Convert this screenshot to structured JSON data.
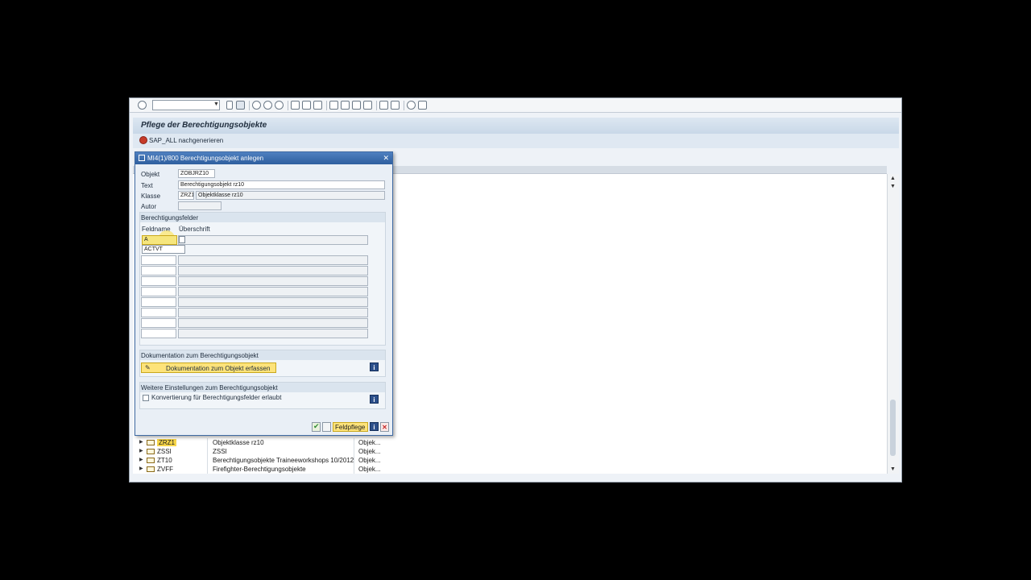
{
  "header": {
    "title": "Pflege der Berechtigungsobjekte"
  },
  "app_toolbar": {
    "regenerate_label": "SAP_ALL nachgenerieren"
  },
  "dialog": {
    "title": "MI4(1)/800 Berechtigungsobjekt anlegen",
    "objekt_label": "Objekt",
    "objekt_value": "ZOBJRZ10",
    "text_label": "Text",
    "text_value": "Berechtigungsobjekt rz10",
    "klasse_label": "Klasse",
    "klasse_value": "ZRZ1",
    "klasse_desc": "Objektklasse rz10",
    "autor_label": "Autor",
    "fields_group": {
      "title": "Berechtigungsfelder",
      "col_feldname": "Feldname",
      "col_ueberschrift": "Überschrift",
      "active_value": "A",
      "suggestion": "ACTVT"
    },
    "doc_group": {
      "title": "Dokumentation zum Berechtigungsobjekt",
      "button_label": "Dokumentation zum Objekt erfassen"
    },
    "settings_group": {
      "title": "Weitere Einstellungen zum Berechtigungsobjekt",
      "checkbox_label": "Konvertierung für Berechtigungsfelder erlaubt"
    },
    "buttons": {
      "field_label": "Feldpflege",
      "info_label": "i",
      "cancel_label": "✕"
    }
  },
  "tree": {
    "rows": [
      {
        "name": "ZRZ1",
        "desc": "Objektklasse rz10",
        "type": "Objek...",
        "selected": true
      },
      {
        "name": "ZSSI",
        "desc": "ZSSI",
        "type": "Objek..."
      },
      {
        "name": "ZT10",
        "desc": "Berechtigungsobjekte Traineeworkshops 10/2012",
        "type": "Objek..."
      },
      {
        "name": "ZVFF",
        "desc": "Firefighter-Berechtigungsobjekte",
        "type": "Objek..."
      }
    ]
  },
  "colors": {
    "title_bar": "#2e5e9e",
    "highlight": "#f7d64a"
  }
}
